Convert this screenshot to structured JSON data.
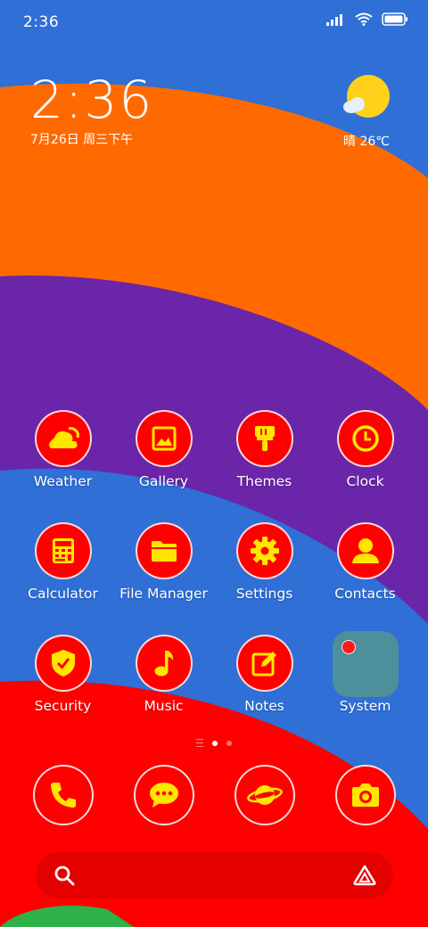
{
  "status_bar": {
    "time": "2:36",
    "icons": [
      "signal-icon",
      "wifi-icon",
      "battery-icon"
    ]
  },
  "clock_widget": {
    "time": "2:36",
    "date": "7月26日 周三下午"
  },
  "weather_widget": {
    "text": "晴 26℃",
    "icon": "partly-sunny-icon"
  },
  "colors": {
    "icon_background": "#ff0000",
    "icon_glyph": "#ffe600",
    "folder_background": "#4d8f9b",
    "wallpaper_blue": "#2f6fd6",
    "wallpaper_orange": "#ff6a00",
    "wallpaper_purple": "#6a25a8",
    "wallpaper_red": "#ff0000",
    "wallpaper_green": "#2db24a"
  },
  "apps": {
    "weather": "Weather",
    "gallery": "Gallery",
    "themes": "Themes",
    "clock": "Clock",
    "calculator": "Calculator",
    "file_manager": "File Manager",
    "settings": "Settings",
    "contacts": "Contacts",
    "security": "Security",
    "music": "Music",
    "notes": "Notes",
    "system": "System"
  },
  "dock": [
    "phone-icon",
    "messages-icon",
    "browser-icon",
    "camera-icon"
  ],
  "page_indicator": {
    "pages": 2,
    "current": 1
  },
  "search": {
    "icons": [
      "search-icon",
      "assistant-icon"
    ]
  }
}
